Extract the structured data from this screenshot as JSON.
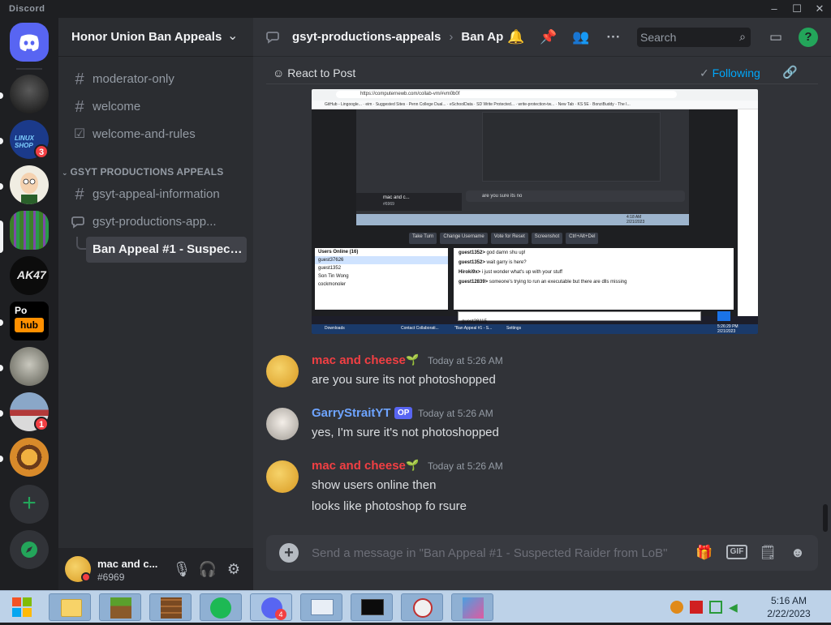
{
  "window": {
    "app_name": "Discord",
    "controls": [
      "–",
      "☐",
      "✕"
    ]
  },
  "servers": [
    {
      "name": "Direct Messages",
      "icon": "discord-logo-icon",
      "color": "#5865f2"
    },
    {
      "name": "dark server",
      "color": "#2a2a2a"
    },
    {
      "name": "Linux Shop",
      "color": "#1b3a8a",
      "badge": "3",
      "icon_text": "LINUX SHOP"
    },
    {
      "name": "Peter server",
      "color": "#e8e4d6"
    },
    {
      "name": "stripes server",
      "color": "#4a8a2e"
    },
    {
      "name": "AK47 Bot",
      "color": "#101010",
      "icon_text": "AK47"
    },
    {
      "name": "Po hub",
      "color": "#000000",
      "icon_text": "Pohub"
    },
    {
      "name": "bw photo server",
      "color": "#8a8a80"
    },
    {
      "name": "building server",
      "color": "#7a8aa0",
      "badge": "1"
    },
    {
      "name": "burger server",
      "color": "#c88a3a"
    }
  ],
  "rail_actions": {
    "add_server": "+",
    "explore": "compass-icon"
  },
  "guild": {
    "name": "Honor Union Ban Appeals",
    "channels_top": [
      {
        "name": "moderator-only",
        "icon": "#"
      },
      {
        "name": "welcome",
        "icon": "#"
      },
      {
        "name": "welcome-and-rules",
        "icon": "☑"
      }
    ],
    "category": "GSYT PRODUCTIONS APPEALS",
    "channels_cat": [
      {
        "name": "gsyt-appeal-information",
        "icon": "#"
      },
      {
        "name": "gsyt-productions-app...",
        "icon": "forum"
      }
    ],
    "thread": {
      "name": "Ban Appeal #1 - Suspect...",
      "selected": true
    }
  },
  "user": {
    "name": "mac and c...",
    "tag": "#6969"
  },
  "header": {
    "forum": "gsyt-productions-appeals",
    "thread": "Ban Ap",
    "search_placeholder": "Search"
  },
  "post_bar": {
    "react": "React to Post",
    "following": "Following"
  },
  "messages": [
    {
      "author": "mac and cheese",
      "color": "#f23f43",
      "time": "Today at 5:26 AM",
      "lines": [
        "are you sure its not photoshopped"
      ],
      "op": false
    },
    {
      "author": "GarryStraitYT",
      "color": "#6ea4ff",
      "time": "Today at 5:26 AM",
      "lines": [
        "yes, I'm sure it's not photoshopped"
      ],
      "op": true,
      "op_label": "OP"
    },
    {
      "author": "mac and cheese",
      "color": "#f23f43",
      "time": "Today at 5:26 AM",
      "lines": [
        "show users online then",
        "looks like photoshop fo rsure"
      ],
      "op": false
    }
  ],
  "composer": {
    "placeholder": "Send a message in \"Ban Appeal #1 - Suspected Raider from LoB\"",
    "gif_label": "GIF"
  },
  "embed_screenshot": {
    "url": "https://computernewb.com/collab-vm/#vm0b0f",
    "bookmarks": [
      "GitHub - Lingoogle...",
      "eim",
      "Suggested Sites",
      "Penn College Dual...",
      "eSchoolData",
      "SD Write Protected...",
      "write-protection-tw...",
      "New Tab",
      "KS 5E",
      "BonziBuddy - The I..."
    ],
    "inner_message": "are you sure its no",
    "inner_user": "mac and c...",
    "inner_tag": "#6969",
    "buttons": [
      "Take Turn",
      "Change Username",
      "Vote for Reset",
      "Screenshot",
      "Ctrl+Alt+Del"
    ],
    "users_header": "Users Online (16)",
    "users": [
      "guest37626",
      "guest1352",
      "Son Tin Wong",
      "cockmonoler"
    ],
    "chat": [
      {
        "user": "guest1352>",
        "text": "god damn shu up!"
      },
      {
        "user": "guest1352>",
        "text": "wait garry is here?"
      },
      {
        "user": "Hiroki9x>",
        "text": "i just wonder what's up with your stuff"
      },
      {
        "user": "guest12839>",
        "text": "someone's trying to run an executable but there are dlls missing"
      }
    ],
    "input_user": "guest28115",
    "taskbar_items": [
      "Downloads",
      "Contact Collaborati...",
      "\"Ban Appeal #1 - S...",
      "Settings"
    ],
    "clock_time": "5:26:29 PM",
    "clock_date": "2/21/2023",
    "inner_vm_time": "4:18 AM",
    "inner_vm_date": "2/21/2023"
  },
  "taskbar": {
    "apps": [
      "start",
      "file-explorer",
      "minecraft",
      "minecraft-crafting",
      "spotify",
      "discord",
      "cpu-monitor",
      "terminal",
      "network-tool",
      "app-icon"
    ],
    "discord_badge": "4",
    "time": "5:16 AM",
    "date": "2/22/2023"
  },
  "colors": {
    "accent": "#5865f2",
    "following": "#00a8fc",
    "mention_red": "#f23f43",
    "op_author": "#6ea4ff"
  }
}
